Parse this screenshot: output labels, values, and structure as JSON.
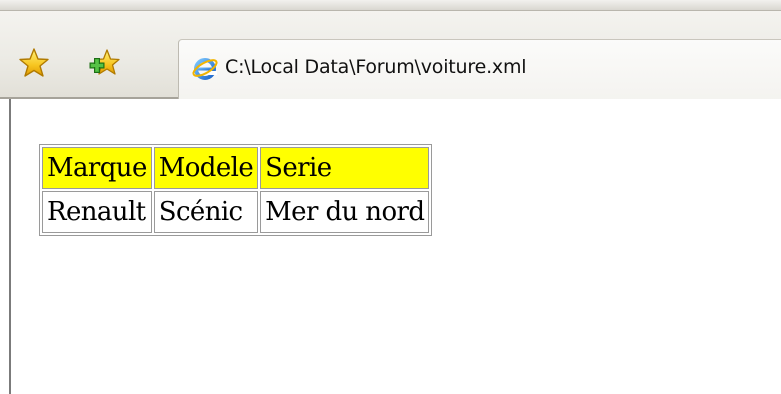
{
  "browser": {
    "tab": {
      "title": "C:\\Local Data\\Forum\\voiture.xml",
      "icon": "ie-icon"
    },
    "toolbar": {
      "favorites_icon": "favorites-star-icon",
      "add_favorites_icon": "add-to-favorites-icon"
    }
  },
  "colors": {
    "header_background": "#ffff00",
    "toolbar_background": "#ecebe5"
  },
  "table": {
    "headers": [
      "Marque",
      "Modele",
      "Serie"
    ],
    "rows": [
      [
        "Renault",
        "Scénic",
        "Mer du nord"
      ]
    ]
  }
}
